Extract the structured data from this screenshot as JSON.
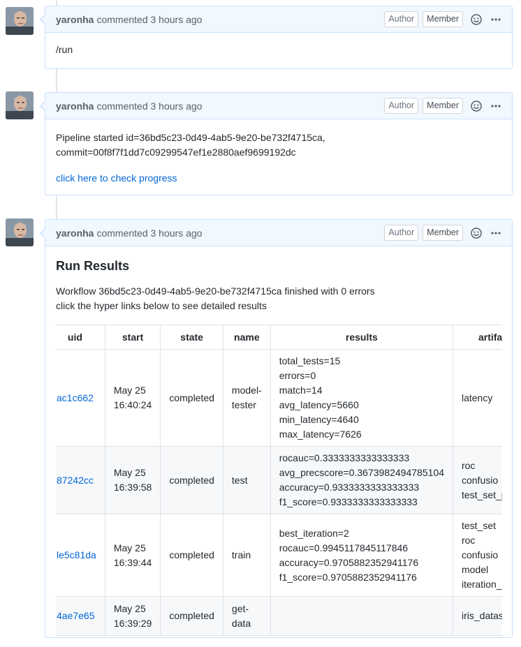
{
  "comments": [
    {
      "author": "yaronha",
      "meta": "commented 3 hours ago",
      "badge_author": "Author",
      "badge_member": "Member",
      "body": "/run"
    },
    {
      "author": "yaronha",
      "meta": "commented 3 hours ago",
      "badge_author": "Author",
      "badge_member": "Member",
      "line1": "Pipeline started id=36bd5c23-0d49-4ab5-9e20-be732f4715ca,",
      "line2": "commit=00f8f7f1dd7c09299547ef1e2880aef9699192dc",
      "link": "click here to check progress"
    },
    {
      "author": "yaronha",
      "meta": "commented 3 hours ago",
      "badge_author": "Author",
      "badge_member": "Member",
      "title": "Run Results",
      "line1": "Workflow 36bd5c23-0d49-4ab5-9e20-be732f4715ca finished with 0 errors",
      "line2": "click the hyper links below to see detailed results"
    }
  ],
  "table": {
    "headers": [
      "uid",
      "start",
      "state",
      "name",
      "results",
      "artifa"
    ],
    "rows": [
      {
        "uid": "ac1c662",
        "start1": "May 25",
        "start2": "16:40:24",
        "state": "completed",
        "name1": "model-",
        "name2": "tester",
        "results": [
          "total_tests=15",
          "errors=0",
          "match=14",
          "avg_latency=5660",
          "min_latency=4640",
          "max_latency=7626"
        ],
        "artifacts": [
          "latency"
        ]
      },
      {
        "uid": "87242cc",
        "start1": "May 25",
        "start2": "16:39:58",
        "state": "completed",
        "name1": "test",
        "name2": "",
        "results": [
          "rocauc=0.3333333333333333",
          "avg_precscore=0.3673982494785104",
          "accuracy=0.9333333333333333",
          "f1_score=0.9333333333333333"
        ],
        "artifacts": [
          "roc",
          "confusio",
          "test_set_p"
        ]
      },
      {
        "uid": "le5c81da",
        "start1": "May 25",
        "start2": "16:39:44",
        "state": "completed",
        "name1": "train",
        "name2": "",
        "results": [
          "best_iteration=2",
          "rocauc=0.9945117845117846",
          "accuracy=0.9705882352941176",
          "f1_score=0.9705882352941176"
        ],
        "artifacts": [
          "test_set",
          "roc",
          "confusio",
          "model",
          "iteration_"
        ]
      },
      {
        "uid": "4ae7e65",
        "start1": "May 25",
        "start2": "16:39:29",
        "state": "completed",
        "name1": "get-",
        "name2": "data",
        "results": [],
        "artifacts": [
          "iris_datas"
        ]
      }
    ]
  },
  "icons": {
    "avatar": "user-avatar",
    "smiley": "smiley-icon",
    "more": "kebab-horizontal-icon"
  },
  "colors": {
    "link": "#0366d6",
    "header_bg": "#f1f8ff",
    "border": "#c8e1ff"
  }
}
